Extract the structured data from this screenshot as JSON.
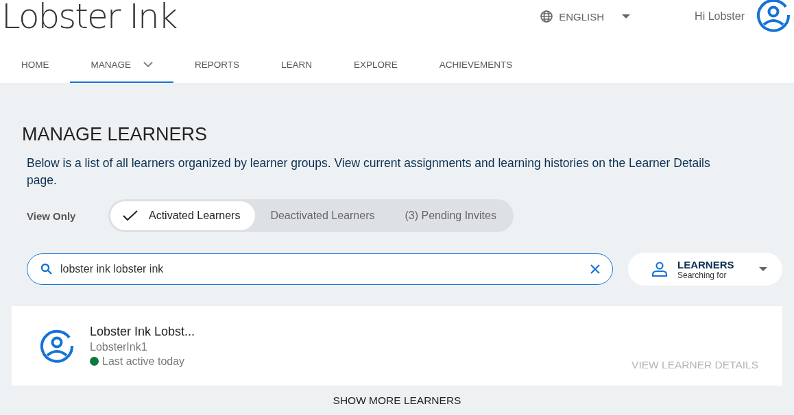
{
  "header": {
    "logo": "Lobster Ink",
    "language": "ENGLISH",
    "greeting": "Hi Lobster"
  },
  "nav": [
    {
      "label": "HOME",
      "selected": false,
      "kind": "link"
    },
    {
      "label": "MANAGE",
      "selected": true,
      "kind": "dropdown"
    },
    {
      "label": "REPORTS",
      "selected": false,
      "kind": "link"
    },
    {
      "label": "LEARN",
      "selected": false,
      "kind": "link"
    },
    {
      "label": "EXPLORE",
      "selected": false,
      "kind": "link"
    },
    {
      "label": "ACHIEVEMENTS",
      "selected": false,
      "kind": "link"
    }
  ],
  "page": {
    "title": "MANAGE LEARNERS",
    "description": "Below is a list of all learners organized by learner groups. View current assignments and learning histories on the Learner Details page."
  },
  "filter": {
    "label": "View Only",
    "options": [
      {
        "label": "Activated Learners",
        "selected": true
      },
      {
        "label": "Deactivated Learners",
        "selected": false
      },
      {
        "label": "(3) Pending Invites",
        "selected": false
      }
    ]
  },
  "search": {
    "value": "lobster ink lobster ink"
  },
  "search_type": {
    "value": "LEARNERS",
    "caption": "Searching for"
  },
  "learners": [
    {
      "name": "Lobster Ink Lobst...",
      "username": "LobsterInk1",
      "status": "Last active today",
      "color": "#0a7a3e",
      "action": "VIEW LEARNER DETAILS",
      "disabled": true
    }
  ],
  "show_more": "SHOW MORE LEARNERS"
}
